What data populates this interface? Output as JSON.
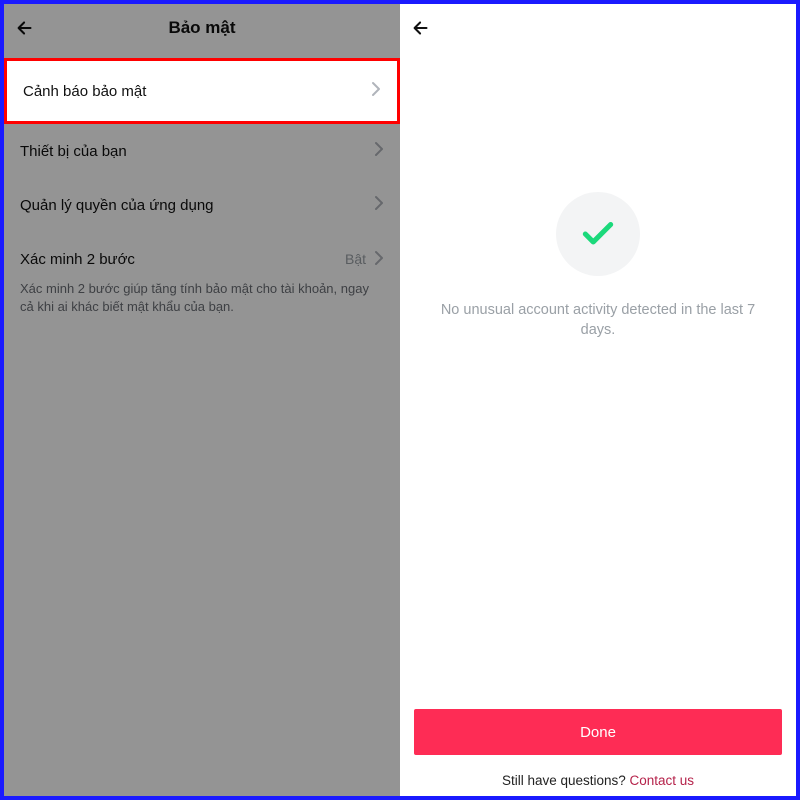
{
  "left": {
    "title": "Bảo mật",
    "items": {
      "security_alerts": "Cảnh báo bảo mật",
      "your_devices": "Thiết bị của bạn",
      "manage_app_permissions": "Quản lý quyền của ứng dụng",
      "two_step": "Xác minh 2 bước",
      "two_step_status": "Bật",
      "two_step_desc": "Xác minh 2 bước giúp tăng tính bảo mật cho tài khoản, ngay cả khi ai khác biết mật khẩu của bạn."
    }
  },
  "right": {
    "status_message": "No unusual account activity detected in the last 7 days.",
    "done_label": "Done",
    "contact_prompt": "Still have questions? ",
    "contact_link": "Contact us"
  },
  "colors": {
    "accent": "#fe2c55",
    "check": "#1bd97b"
  }
}
